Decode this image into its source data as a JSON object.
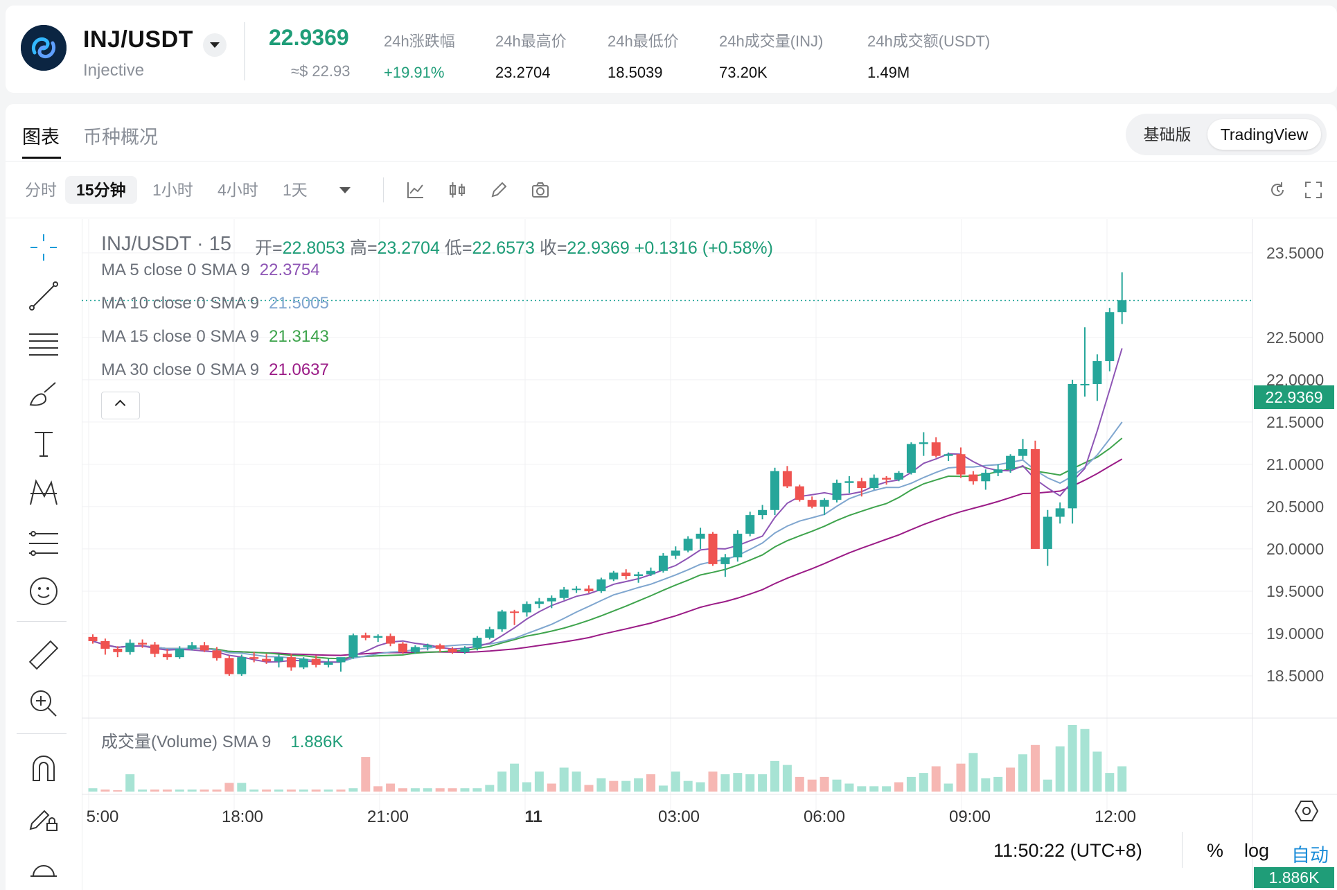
{
  "header": {
    "pair": "INJ/USDT",
    "coin_name": "Injective",
    "price": "22.9369",
    "price_usd": "≈$ 22.93",
    "stats": [
      {
        "label": "24h涨跌幅",
        "value": "+19.91%",
        "up": true
      },
      {
        "label": "24h最高价",
        "value": "23.2704"
      },
      {
        "label": "24h最低价",
        "value": "18.5039"
      },
      {
        "label": "24h成交量(INJ)",
        "value": "73.20K"
      },
      {
        "label": "24h成交额(USDT)",
        "value": "1.49M"
      }
    ]
  },
  "tabs": [
    "图表",
    "币种概况"
  ],
  "view_switch": [
    "基础版",
    "TradingView"
  ],
  "timeframes": [
    "分时",
    "15分钟",
    "1小时",
    "4小时",
    "1天"
  ],
  "legend": {
    "title": "INJ/USDT · 15",
    "open_label": "开=",
    "open": "22.8053",
    "high_label": "高=",
    "high": "23.2704",
    "low_label": "低=",
    "low": "22.6573",
    "close_label": "收=",
    "close": "22.9369",
    "change": "+0.1316 (+0.58%)",
    "ma": [
      {
        "label": "MA 5 close 0 SMA 9",
        "value": "22.3754",
        "color": "#8e55b5"
      },
      {
        "label": "MA 10 close 0 SMA 9",
        "value": "21.5005",
        "color": "#7fa6cf"
      },
      {
        "label": "MA 15 close 0 SMA 9",
        "value": "21.3143",
        "color": "#3fa44d"
      },
      {
        "label": "MA 30 close 0 SMA 9",
        "value": "21.0637",
        "color": "#9b1c87"
      }
    ],
    "volume_label": "成交量(Volume) SMA 9",
    "volume_value": "1.886K"
  },
  "footer": {
    "time": "11:50:22 (UTC+8)",
    "options": [
      "%",
      "log",
      "自动"
    ]
  },
  "chart_data": {
    "type": "candlestick",
    "interval": "15m",
    "y_ticks": [
      "23.5000",
      "22.5000",
      "22.0000",
      "21.5000",
      "21.0000",
      "20.5000",
      "20.0000",
      "19.5000",
      "19.0000",
      "18.5000"
    ],
    "ylim": [
      18.0,
      23.9
    ],
    "x_ticks": [
      "5:00",
      "18:00",
      "21:00",
      "11",
      "03:00",
      "06:00",
      "09:00",
      "12:00"
    ],
    "last_price_tag": "22.9369",
    "last_volume_tag": "1.886K",
    "colors": {
      "up": "#26a69a",
      "down": "#ef5350",
      "up_vol": "#a7e3d4",
      "down_vol": "#f6b7b3"
    },
    "candles": [
      [
        18.96,
        18.99,
        18.88,
        18.91
      ],
      [
        18.91,
        18.94,
        18.75,
        18.82
      ],
      [
        18.82,
        18.85,
        18.72,
        18.78
      ],
      [
        18.78,
        18.93,
        18.75,
        18.89
      ],
      [
        18.89,
        18.93,
        18.83,
        18.87
      ],
      [
        18.87,
        18.9,
        18.72,
        18.76
      ],
      [
        18.76,
        18.82,
        18.69,
        18.72
      ],
      [
        18.72,
        18.85,
        18.7,
        18.82
      ],
      [
        18.82,
        18.9,
        18.8,
        18.86
      ],
      [
        18.86,
        18.9,
        18.78,
        18.8
      ],
      [
        18.8,
        18.84,
        18.68,
        18.71
      ],
      [
        18.71,
        18.74,
        18.5,
        18.52
      ],
      [
        18.52,
        18.75,
        18.5,
        18.72
      ],
      [
        18.72,
        18.78,
        18.66,
        18.7
      ],
      [
        18.7,
        18.76,
        18.64,
        18.67
      ],
      [
        18.67,
        18.75,
        18.6,
        18.72
      ],
      [
        18.72,
        18.76,
        18.56,
        18.6
      ],
      [
        18.6,
        18.72,
        18.58,
        18.7
      ],
      [
        18.7,
        18.74,
        18.6,
        18.63
      ],
      [
        18.63,
        18.7,
        18.6,
        18.66
      ],
      [
        18.66,
        18.7,
        18.55,
        18.72
      ],
      [
        18.72,
        19.0,
        18.7,
        18.98
      ],
      [
        18.98,
        19.01,
        18.92,
        18.95
      ],
      [
        18.95,
        18.99,
        18.9,
        18.97
      ],
      [
        18.97,
        19.0,
        18.85,
        18.88
      ],
      [
        18.88,
        18.9,
        18.76,
        18.78
      ],
      [
        18.78,
        18.86,
        18.76,
        18.84
      ],
      [
        18.84,
        18.88,
        18.8,
        18.86
      ],
      [
        18.86,
        18.88,
        18.78,
        18.82
      ],
      [
        18.82,
        18.84,
        18.76,
        18.78
      ],
      [
        18.78,
        18.85,
        18.76,
        18.83
      ],
      [
        18.83,
        18.97,
        18.8,
        18.95
      ],
      [
        18.95,
        19.08,
        18.93,
        19.05
      ],
      [
        19.05,
        19.28,
        19.02,
        19.26
      ],
      [
        19.26,
        19.28,
        19.1,
        19.25
      ],
      [
        19.25,
        19.38,
        19.2,
        19.35
      ],
      [
        19.35,
        19.42,
        19.3,
        19.38
      ],
      [
        19.38,
        19.45,
        19.3,
        19.42
      ],
      [
        19.42,
        19.55,
        19.4,
        19.52
      ],
      [
        19.52,
        19.56,
        19.48,
        19.53
      ],
      [
        19.53,
        19.57,
        19.48,
        19.5
      ],
      [
        19.5,
        19.66,
        19.48,
        19.64
      ],
      [
        19.64,
        19.74,
        19.62,
        19.72
      ],
      [
        19.72,
        19.76,
        19.64,
        19.68
      ],
      [
        19.68,
        19.73,
        19.6,
        19.7
      ],
      [
        19.7,
        19.78,
        19.68,
        19.74
      ],
      [
        19.74,
        19.95,
        19.72,
        19.92
      ],
      [
        19.92,
        20.03,
        19.88,
        19.98
      ],
      [
        19.98,
        20.15,
        19.96,
        20.12
      ],
      [
        20.12,
        20.25,
        20.0,
        20.18
      ],
      [
        20.18,
        20.2,
        19.8,
        19.82
      ],
      [
        19.82,
        19.94,
        19.67,
        19.9
      ],
      [
        19.9,
        20.22,
        19.85,
        20.18
      ],
      [
        20.18,
        20.44,
        20.15,
        20.4
      ],
      [
        20.4,
        20.52,
        20.35,
        20.46
      ],
      [
        20.46,
        20.96,
        20.4,
        20.92
      ],
      [
        20.92,
        20.98,
        20.72,
        20.74
      ],
      [
        20.74,
        20.76,
        20.56,
        20.58
      ],
      [
        20.58,
        20.62,
        20.48,
        20.5
      ],
      [
        20.5,
        20.6,
        20.4,
        20.58
      ],
      [
        20.58,
        20.82,
        20.55,
        20.78
      ],
      [
        20.78,
        20.86,
        20.66,
        20.8
      ],
      [
        20.8,
        20.84,
        20.62,
        20.72
      ],
      [
        20.72,
        20.88,
        20.7,
        20.84
      ],
      [
        20.84,
        20.86,
        20.76,
        20.82
      ],
      [
        20.82,
        20.92,
        20.8,
        20.9
      ],
      [
        20.9,
        21.26,
        20.88,
        21.24
      ],
      [
        21.24,
        21.38,
        21.1,
        21.26
      ],
      [
        21.26,
        21.32,
        21.08,
        21.1
      ],
      [
        21.1,
        21.14,
        21.04,
        21.12
      ],
      [
        21.12,
        21.2,
        20.84,
        20.88
      ],
      [
        20.88,
        20.92,
        20.76,
        20.8
      ],
      [
        20.8,
        20.94,
        20.7,
        20.9
      ],
      [
        20.9,
        21.0,
        20.86,
        20.94
      ],
      [
        20.94,
        21.12,
        20.9,
        21.1
      ],
      [
        21.1,
        21.3,
        21.06,
        21.18
      ],
      [
        21.18,
        21.28,
        20.2,
        20.0
      ],
      [
        20.0,
        20.46,
        19.8,
        20.38
      ],
      [
        20.38,
        20.55,
        20.3,
        20.48
      ],
      [
        20.48,
        22.0,
        20.3,
        21.95
      ],
      [
        21.95,
        22.62,
        21.8,
        21.95
      ],
      [
        21.95,
        22.3,
        21.75,
        22.22
      ],
      [
        22.22,
        22.85,
        22.1,
        22.8
      ],
      [
        22.8,
        23.27,
        22.66,
        22.94
      ]
    ],
    "volume": [
      [
        0.05,
        1
      ],
      [
        0.03,
        0
      ],
      [
        0.02,
        0
      ],
      [
        0.26,
        1
      ],
      [
        0.03,
        1
      ],
      [
        0.03,
        0
      ],
      [
        0.03,
        0
      ],
      [
        0.03,
        1
      ],
      [
        0.03,
        1
      ],
      [
        0.03,
        0
      ],
      [
        0.03,
        0
      ],
      [
        0.13,
        0
      ],
      [
        0.13,
        1
      ],
      [
        0.03,
        1
      ],
      [
        0.03,
        0
      ],
      [
        0.03,
        1
      ],
      [
        0.03,
        0
      ],
      [
        0.03,
        1
      ],
      [
        0.03,
        0
      ],
      [
        0.03,
        1
      ],
      [
        0.03,
        0
      ],
      [
        0.05,
        1
      ],
      [
        0.52,
        0
      ],
      [
        0.08,
        0
      ],
      [
        0.12,
        0
      ],
      [
        0.05,
        0
      ],
      [
        0.05,
        1
      ],
      [
        0.05,
        1
      ],
      [
        0.05,
        0
      ],
      [
        0.05,
        0
      ],
      [
        0.05,
        1
      ],
      [
        0.05,
        1
      ],
      [
        0.1,
        1
      ],
      [
        0.3,
        1
      ],
      [
        0.42,
        1
      ],
      [
        0.14,
        1
      ],
      [
        0.3,
        1
      ],
      [
        0.12,
        0
      ],
      [
        0.36,
        1
      ],
      [
        0.3,
        1
      ],
      [
        0.1,
        0
      ],
      [
        0.2,
        1
      ],
      [
        0.16,
        0
      ],
      [
        0.16,
        1
      ],
      [
        0.2,
        1
      ],
      [
        0.26,
        0
      ],
      [
        0.09,
        1
      ],
      [
        0.3,
        1
      ],
      [
        0.16,
        1
      ],
      [
        0.14,
        1
      ],
      [
        0.3,
        0
      ],
      [
        0.26,
        1
      ],
      [
        0.28,
        1
      ],
      [
        0.26,
        1
      ],
      [
        0.26,
        1
      ],
      [
        0.46,
        1
      ],
      [
        0.4,
        1
      ],
      [
        0.22,
        0
      ],
      [
        0.18,
        0
      ],
      [
        0.22,
        0
      ],
      [
        0.18,
        1
      ],
      [
        0.12,
        1
      ],
      [
        0.08,
        1
      ],
      [
        0.08,
        1
      ],
      [
        0.08,
        1
      ],
      [
        0.14,
        0
      ],
      [
        0.22,
        1
      ],
      [
        0.28,
        1
      ],
      [
        0.38,
        0
      ],
      [
        0.12,
        1
      ],
      [
        0.42,
        0
      ],
      [
        0.58,
        1
      ],
      [
        0.2,
        1
      ],
      [
        0.22,
        1
      ],
      [
        0.36,
        0
      ],
      [
        0.56,
        1
      ],
      [
        0.7,
        0
      ],
      [
        0.18,
        1
      ],
      [
        0.68,
        1
      ],
      [
        1.0,
        1
      ],
      [
        0.94,
        1
      ],
      [
        0.6,
        1
      ],
      [
        0.28,
        1
      ],
      [
        0.38,
        1
      ]
    ]
  }
}
